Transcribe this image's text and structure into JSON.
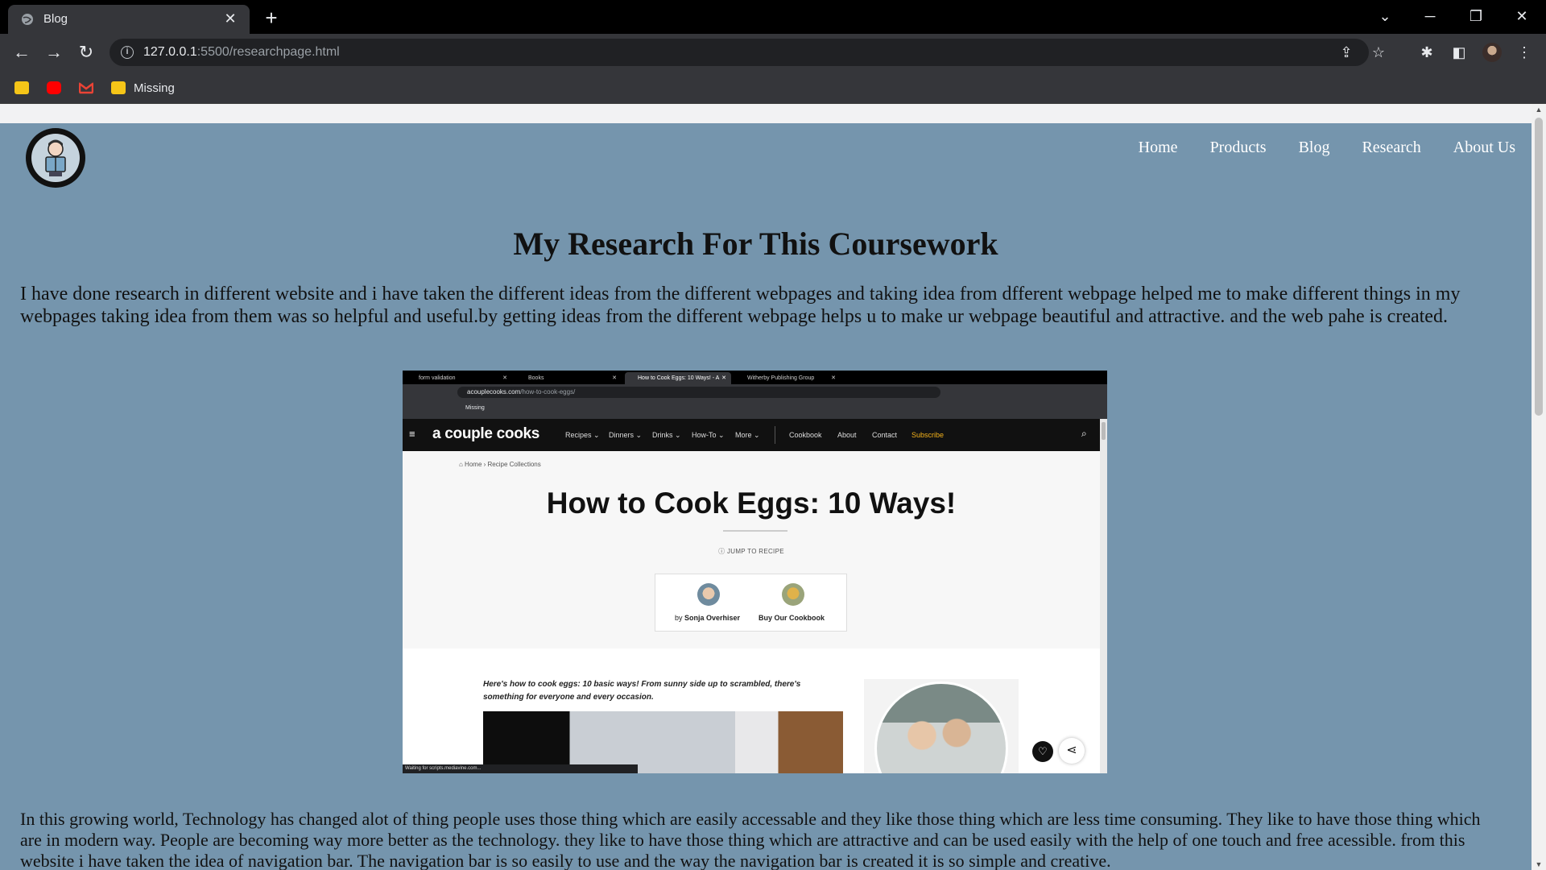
{
  "browser": {
    "tab_title": "Blog",
    "url_host": "127.0.0.1",
    "url_path": ":5500/researchpage.html",
    "bookmarks": [
      {
        "label": ""
      },
      {
        "label": ""
      },
      {
        "label": ""
      },
      {
        "label": "Missing"
      }
    ]
  },
  "site": {
    "nav": [
      "Home",
      "Products",
      "Blog",
      "Research",
      "About Us"
    ],
    "title": "My Research For This Coursework",
    "para1": "I have done research in different website and i have taken the different ideas from the different webpages and taking idea from dfferent webpage helped me to make different things in my webpages taking idea from them was so helpful and useful.by getting ideas from the different webpage helps u to make ur webpage beautiful and attractive. and the web pahe is created.",
    "para2": "In this growing world, Technology has changed alot of thing people uses those thing which are easily accessable and they like those thing which are less time consuming. They like to have those thing which are in modern way. People are becoming way more better as the technology. they like to have those thing which are attractive and can be used easily with the help of one touch and free acessible. from this website i have taken the idea of navigation bar. The navigation bar is so easily to use and the way the navigation bar is created it is so simple and creative."
  },
  "screenshot": {
    "tabs": [
      "form validation",
      "Books",
      "How to Cook Eggs: 10 Ways! - A",
      "Witherby Publishing Group"
    ],
    "url_host": "acouplecooks.com",
    "url_path": "/how-to-cook-eggs/",
    "bookmark_label": "Missing",
    "brand": "a couple cooks",
    "menu": [
      "Recipes ⌄",
      "Dinners ⌄",
      "Drinks ⌄",
      "How-To ⌄",
      "More ⌄",
      "Cookbook",
      "About",
      "Contact",
      "Subscribe"
    ],
    "breadcrumb": "⌂  Home   ›  Recipe Collections",
    "headline": "How to Cook Eggs: 10 Ways!",
    "jump": "ⓘ  JUMP TO RECIPE",
    "author_by": "by ",
    "author": "Sonja Overhiser",
    "cookbook": "Buy Our Cookbook",
    "intro": "Here's how to cook eggs: 10 basic ways! From sunny side up to scrambled, there's something for everyone and every occasion.",
    "status": "Waiting for scripts.mediavine.com..."
  },
  "colors": {
    "page_bg": "#7595ad",
    "accent_subscribe": "#f5b21b"
  }
}
